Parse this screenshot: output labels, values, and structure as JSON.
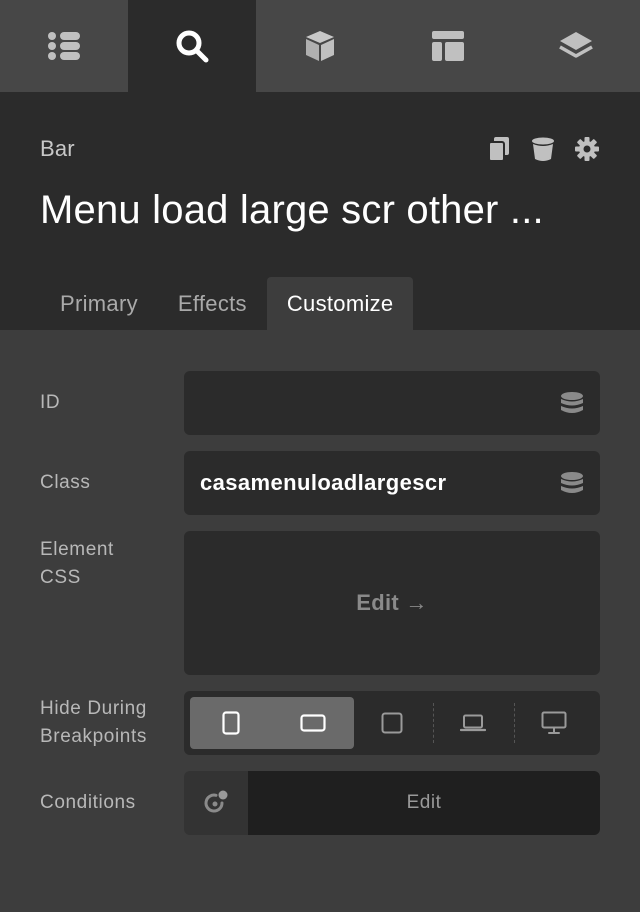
{
  "topbar": {
    "tabs": [
      {
        "icon": "list-icon"
      },
      {
        "icon": "search-icon",
        "active": true
      },
      {
        "icon": "cube-icon"
      },
      {
        "icon": "layout-icon"
      },
      {
        "icon": "layers-icon"
      }
    ]
  },
  "header": {
    "breadcrumb": "Bar",
    "title": "Menu load large scr other ...",
    "actions": [
      "duplicate-icon",
      "trash-icon",
      "gear-icon"
    ]
  },
  "subtabs": {
    "primary": "Primary",
    "effects": "Effects",
    "customize": "Customize",
    "active": "Customize"
  },
  "form": {
    "id_label": "ID",
    "id_value": "",
    "class_label": "Class",
    "class_value": "casamenuloadlargescr",
    "css_label_1": "Element",
    "css_label_2": "CSS",
    "css_edit": "Edit →",
    "hide_label_1": "Hide During",
    "hide_label_2": "Breakpoints",
    "breakpoints": [
      "phone",
      "phone-landscape",
      "tablet",
      "laptop",
      "desktop"
    ],
    "conditions_label": "Conditions",
    "conditions_edit": "Edit"
  },
  "colors": {
    "panel": "#3d3d3d",
    "header": "#2b2b2b",
    "topbar": "#474747",
    "field": "#2b2b2b",
    "selected_group": "#6a6a6a"
  }
}
